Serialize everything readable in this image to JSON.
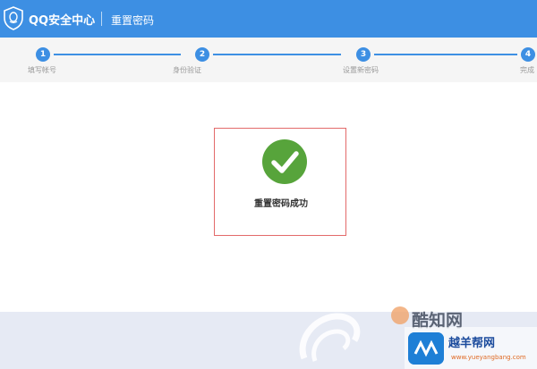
{
  "header": {
    "app_name": "QQ安全中心",
    "page_title": "重置密码"
  },
  "steps": [
    {
      "number": "1",
      "label": "填写帐号"
    },
    {
      "number": "2",
      "label": "身份验证"
    },
    {
      "number": "3",
      "label": "设置新密码"
    },
    {
      "number": "4",
      "label": "完成"
    }
  ],
  "result": {
    "message": "重置密码成功",
    "status": "success"
  },
  "watermarks": {
    "brand_a": "酷知网",
    "brand_b": "越羊帮网",
    "brand_b_url": "www.yueyangbang.com"
  },
  "colors": {
    "header_blue": "#3d8fe3",
    "success_green": "#57a43b",
    "highlight_red": "#e36a6a"
  }
}
